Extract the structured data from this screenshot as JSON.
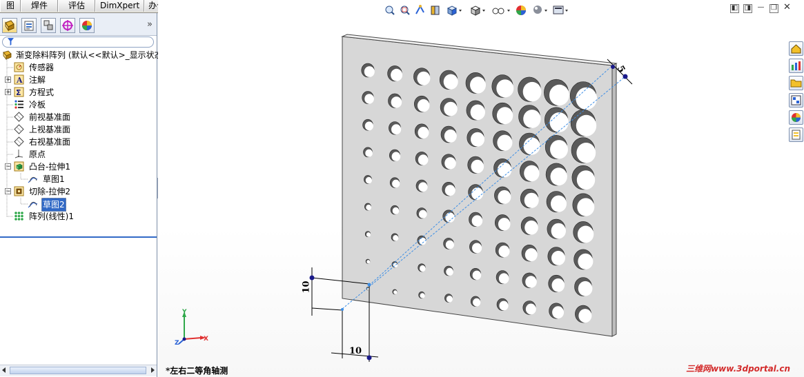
{
  "top_tabs": [
    "图",
    "焊件",
    "评估",
    "DimXpert",
    "办公室产品"
  ],
  "filter_icon": "filter-icon",
  "tree": {
    "root": "渐变除料阵列  (默认<<默认>_显示状态",
    "items": [
      {
        "label": "传感器",
        "icon": "sensor-icon"
      },
      {
        "label": "注解",
        "icon": "annotation-icon",
        "expandable": true
      },
      {
        "label": "方程式",
        "icon": "equation-icon",
        "expandable": true
      },
      {
        "label": "冷板",
        "icon": "sheet-list-icon"
      },
      {
        "label": "前视基准面",
        "icon": "plane-icon"
      },
      {
        "label": "上视基准面",
        "icon": "plane-icon"
      },
      {
        "label": "右视基准面",
        "icon": "plane-icon"
      },
      {
        "label": "原点",
        "icon": "origin-icon"
      },
      {
        "label": "凸台-拉伸1",
        "icon": "extrude-icon",
        "expandable": true,
        "expanded": true
      },
      {
        "label": "草图1",
        "icon": "sketch-icon",
        "child": true
      },
      {
        "label": "切除-拉伸2",
        "icon": "cut-extrude-icon",
        "expandable": true,
        "expanded": true
      },
      {
        "label": "草图2",
        "icon": "sketch-icon",
        "child": true,
        "selected": true
      },
      {
        "label": "阵列(线性)1",
        "icon": "linear-pattern-icon"
      }
    ]
  },
  "viewport": {
    "view_name": "*左右二等角轴测",
    "watermark": "三维网www.3dportal.cn",
    "dim_diagonal": "5",
    "dim_vertical": "10",
    "dim_horizontal": "10",
    "triad": {
      "x": "X",
      "y": "Y",
      "z": "Z"
    }
  },
  "colors": {
    "selection": "#3169c6",
    "plate": "#d8d8d8",
    "dimension": "#000000",
    "pattern_axis": "#3c8ee6"
  }
}
